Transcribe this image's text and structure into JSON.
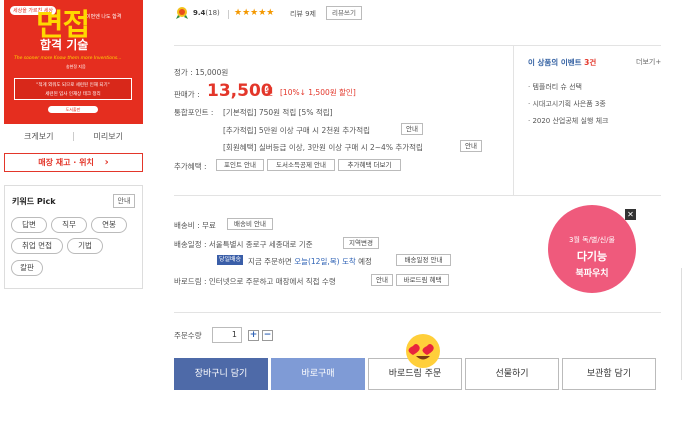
{
  "book": {
    "cover_sticker": "세상을 가르친 세상",
    "cover_sticker2": "이번엔 나도 합격",
    "cover_title": "면접",
    "cover_subtitle": "합격 기술",
    "cover_english": "The sooner more Know them more Inventions...",
    "cover_author": "송현정 지음",
    "cover_box_text": "\"적게 외워도 되므로 세련된 인재 되기\"",
    "cover_box_text2": "세련된 입사 인재상 테크 정리",
    "cover_publisher": "도서출판"
  },
  "left": {
    "zoom_view": "크게보기",
    "preview": "미리보기",
    "stock_button": "매장 재고 · 위치",
    "stock_arrow": "›",
    "keyword_title": "키워드 Pick",
    "keyword_info": "안내",
    "keywords": [
      "답변",
      "직무",
      "연봉",
      "취업 면접",
      "기법",
      "칼판"
    ]
  },
  "rating": {
    "score": "9.4",
    "count": "(18)",
    "stars": "★★★★★",
    "review_count": "리뷰 9제",
    "review_write": "리뷰쓰기"
  },
  "price": {
    "list_label": "정가 : 15,000원",
    "sale_label": "판매가 :",
    "sale_price": "13,500",
    "won": "원",
    "discount": "[10%↓ 1,500원 할인]",
    "points_label": "통합포인트 :",
    "points_basic": "[기본적립] 750원 적립 [5% 적립]",
    "points_extra": "[추가적립] 5만원 이상 구매 시 2천원 추가적립",
    "points_member": "[회원혜택] 실버등급 이상, 3만원 이상 구매 시 2~4% 추가적립",
    "info_btn": "안내",
    "benefit_label": "추가혜택 :",
    "benefit_btns": [
      "포인트 안내",
      "도서소득공제 안내",
      "추가혜택 더보기"
    ]
  },
  "events": {
    "title": "이 상품의 이벤트",
    "count": "3건",
    "more": "더보기+",
    "items": [
      "· 템플러티 슈 선택",
      "· 시대고시기획 사은품 3종",
      "· 2020 산업공체 실행 체크"
    ]
  },
  "delivery": {
    "fee_label": "배송비 : 무료",
    "fee_btn": "배송비 안내",
    "schedule_label": "배송일정 : 서울특별시 종로구 세종대로 기준",
    "region_btn": "지역변경",
    "badge": "당일배송",
    "arrival_prefix": "지금 주문하면",
    "arrival_date": "오늘(12일,목) 도착",
    "arrival_suffix": "예정",
    "arrival_btn": "배송일정 안내",
    "barodrim_label": "바로드림 : 인터넷으로 주문하고 매장에서 직접 수령",
    "barodrim_info": "안내",
    "barodrim_benefit": "바로드림 혜택"
  },
  "promo": {
    "line1": "3월 독/별/신/물",
    "line2": "다기능",
    "line3": "북파우치",
    "close": "✕"
  },
  "order": {
    "qty_label": "주문수량",
    "qty_value": "1",
    "plus": "+",
    "minus": "−",
    "buttons": [
      "장바구니 담기",
      "바로구매",
      "바로드림 주문",
      "선물하기",
      "보관함 담기"
    ]
  },
  "colors": {
    "accent_red": "#e3362a",
    "cart_blue": "#4e6aa8",
    "buy_blue": "#7f9bd6",
    "promo_pink": "#ef5a7c",
    "link_blue": "#2e62b5"
  }
}
